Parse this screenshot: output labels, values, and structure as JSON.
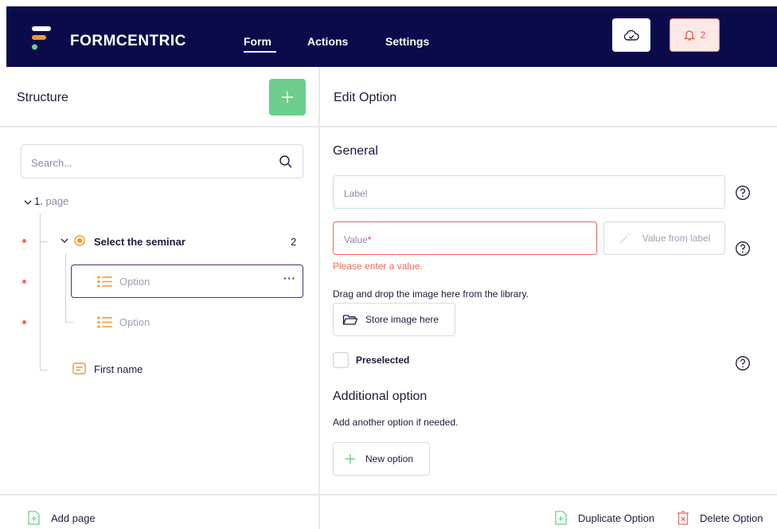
{
  "app": {
    "brand": "FORMCENTRIC",
    "nav": {
      "form": "Form",
      "actions": "Actions",
      "settings": "Settings"
    },
    "notifications_count": "2"
  },
  "structure": {
    "title": "Structure",
    "search_placeholder": "Search...",
    "tree": {
      "page_number": "1.",
      "page_label": "page",
      "select_label": "Select the seminar",
      "select_count": "2",
      "option1": "Option",
      "option2": "Option",
      "option_menu": "···",
      "first_name": "First name"
    },
    "add_page": "Add page"
  },
  "editor": {
    "title": "Edit Option",
    "general_title": "General",
    "label_placeholder": "Label",
    "value_placeholder": "Value",
    "required_mark": "*",
    "value_from_label": "Value from label",
    "error_message": "Please enter a value.",
    "image_hint": "Drag and drop the image here from the library.",
    "store_image": "Store image here",
    "preselected": "Preselected",
    "additional_title": "Additional option",
    "additional_hint": "Add another option if needed.",
    "new_option": "New option",
    "duplicate": "Duplicate Option",
    "delete": "Delete Option"
  },
  "colors": {
    "topbar": "#0b0b4b",
    "accent_green": "#6dce8e",
    "accent_orange": "#f5962f",
    "error_red": "#ef6b61"
  }
}
